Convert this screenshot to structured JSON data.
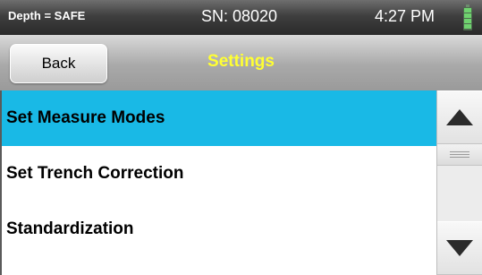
{
  "status_bar": {
    "depth": "Depth = SAFE",
    "serial": "SN: 08020",
    "time": "4:27 PM",
    "battery_icon": "battery-full-icon",
    "battery_color": "#6fd36f"
  },
  "header": {
    "back_label": "Back",
    "title": "Settings",
    "title_color": "#ffff33"
  },
  "list": {
    "items": [
      {
        "label": "Set Measure Modes",
        "selected": true
      },
      {
        "label": "Set Trench Correction",
        "selected": false
      },
      {
        "label": "Standardization",
        "selected": false
      }
    ],
    "selected_color": "#19b9e6"
  },
  "scrollbar": {
    "up_icon": "triangle-up-icon",
    "down_icon": "triangle-down-icon"
  }
}
